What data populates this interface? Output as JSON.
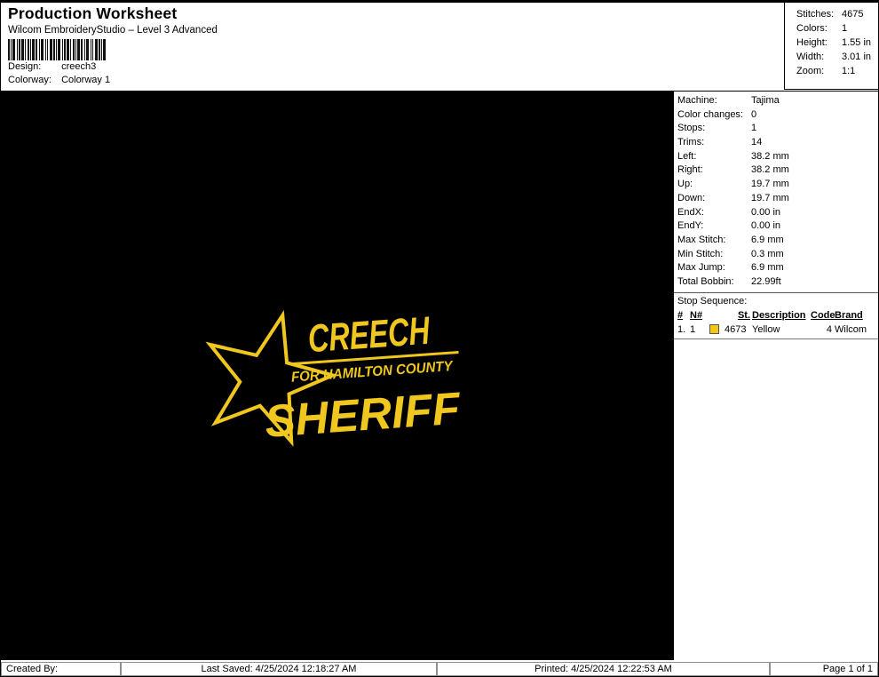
{
  "header": {
    "title": "Production Worksheet",
    "subtitle": "Wilcom EmbroideryStudio – Level 3 Advanced",
    "design_label": "Design:",
    "design_value": "creech3",
    "colorway_label": "Colorway:",
    "colorway_value": "Colorway 1"
  },
  "summary": {
    "rows": [
      {
        "label": "Stitches:",
        "value": "4675"
      },
      {
        "label": "Colors:",
        "value": "1"
      },
      {
        "label": "Height:",
        "value": "1.55 in"
      },
      {
        "label": "Width:",
        "value": "3.01 in"
      },
      {
        "label": "Zoom:",
        "value": "1:1"
      }
    ]
  },
  "machine_info": {
    "rows": [
      {
        "label": "Machine:",
        "value": "Tajima"
      },
      {
        "label": "Color changes:",
        "value": "0"
      },
      {
        "label": "Stops:",
        "value": "1"
      },
      {
        "label": "Trims:",
        "value": "14"
      },
      {
        "label": "Left:",
        "value": "38.2 mm"
      },
      {
        "label": "Right:",
        "value": "38.2 mm"
      },
      {
        "label": "Up:",
        "value": "19.7 mm"
      },
      {
        "label": "Down:",
        "value": "19.7 mm"
      },
      {
        "label": "EndX:",
        "value": "0.00 in"
      },
      {
        "label": "EndY:",
        "value": "0.00 in"
      },
      {
        "label": "Max Stitch:",
        "value": "6.9 mm"
      },
      {
        "label": "Min Stitch:",
        "value": "0.3 mm"
      },
      {
        "label": "Max Jump:",
        "value": "6.9 mm"
      },
      {
        "label": "Total Bobbin:",
        "value": "22.99ft"
      }
    ]
  },
  "stop_sequence": {
    "title": "Stop Sequence:",
    "columns": {
      "num": "#",
      "n": "N#",
      "st": "St.",
      "description": "Description",
      "code": "Code",
      "brand": "Brand"
    },
    "rows": [
      {
        "num": "1.",
        "n": "1",
        "swatch_color": "#f2c713",
        "st": "4673",
        "description": "Yellow",
        "code": "4",
        "brand": "Wilcom"
      }
    ]
  },
  "design_preview": {
    "background": "#000000",
    "thread_color": "#efc71f",
    "line1": "CREECH",
    "line2": "FOR HAMILTON COUNTY",
    "line3": "SHERIFF"
  },
  "footer": {
    "created_by": "Created By:",
    "last_saved": "Last Saved: 4/25/2024 12:18:27 AM",
    "printed": "Printed: 4/25/2024 12:22:53 AM",
    "page": "Page 1 of 1"
  }
}
